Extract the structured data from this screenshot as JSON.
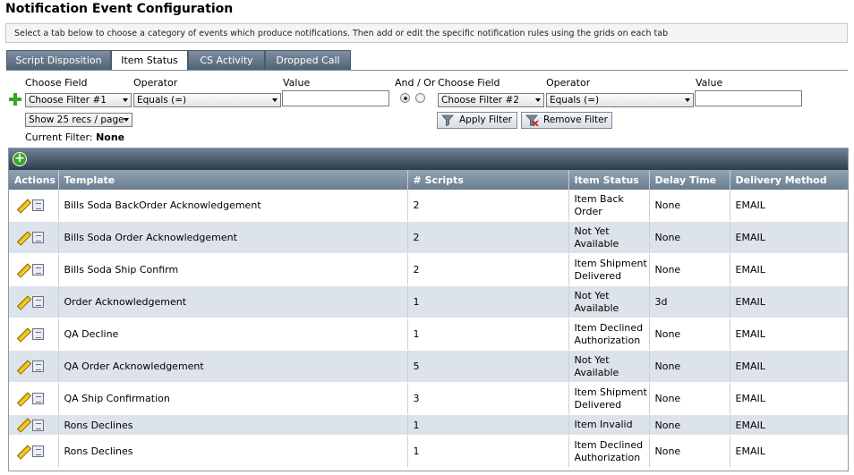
{
  "page": {
    "title": "Notification Event Configuration",
    "instructions": "Select a tab below to choose a category of events which produce notifications. Then add or edit the specific notification rules using the grids on each tab"
  },
  "tabs": [
    {
      "label": "Script Disposition",
      "active": false
    },
    {
      "label": "Item Status",
      "active": true
    },
    {
      "label": "CS Activity",
      "active": false
    },
    {
      "label": "Dropped Call",
      "active": false
    }
  ],
  "filter": {
    "choose_field_label": "Choose Field",
    "operator_label": "Operator",
    "value_label": "Value",
    "and_or_label": "And / Or",
    "filter1": {
      "field": "Choose Filter #1",
      "operator": "Equals (=)",
      "value": ""
    },
    "filter2": {
      "field": "Choose Filter #2",
      "operator": "Equals (=)",
      "value": ""
    },
    "page_size": "Show 25 recs / page",
    "apply_label": "Apply Filter",
    "remove_label": "Remove Filter",
    "current_filter_label": "Current Filter:",
    "current_filter_value": "None"
  },
  "grid": {
    "columns": [
      "Actions",
      "Template",
      "# Scripts",
      "Item Status",
      "Delay Time",
      "Delivery Method"
    ],
    "rows": [
      {
        "template": "Bills Soda BackOrder Acknowledgement",
        "scripts": "2",
        "status": "Item Back Order",
        "delay": "None",
        "method": "EMAIL"
      },
      {
        "template": "Bills Soda Order Acknowledgement",
        "scripts": "2",
        "status": "Not Yet Available",
        "delay": "None",
        "method": "EMAIL"
      },
      {
        "template": "Bills Soda Ship Confirm",
        "scripts": "2",
        "status": "Item Shipment Delivered",
        "delay": "None",
        "method": "EMAIL"
      },
      {
        "template": "Order Acknowledgement",
        "scripts": "1",
        "status": "Not Yet Available",
        "delay": "3d",
        "method": "EMAIL"
      },
      {
        "template": "QA Decline",
        "scripts": "1",
        "status": "Item Declined Authorization",
        "delay": "None",
        "method": "EMAIL"
      },
      {
        "template": "QA Order Acknowledgement",
        "scripts": "5",
        "status": "Not Yet Available",
        "delay": "None",
        "method": "EMAIL"
      },
      {
        "template": "QA Ship Confirmation",
        "scripts": "3",
        "status": "Item Shipment Delivered",
        "delay": "None",
        "method": "EMAIL"
      },
      {
        "template": "Rons Declines",
        "scripts": "1",
        "status": "Item Invalid",
        "delay": "None",
        "method": "EMAIL"
      },
      {
        "template": "Rons Declines",
        "scripts": "1",
        "status": "Item Declined Authorization",
        "delay": "None",
        "method": "EMAIL"
      }
    ]
  },
  "colors": {
    "accent": "#4f6274",
    "header": "#6a7d8f",
    "row_alt": "#dde3ea",
    "add_green": "#3aa42a"
  }
}
